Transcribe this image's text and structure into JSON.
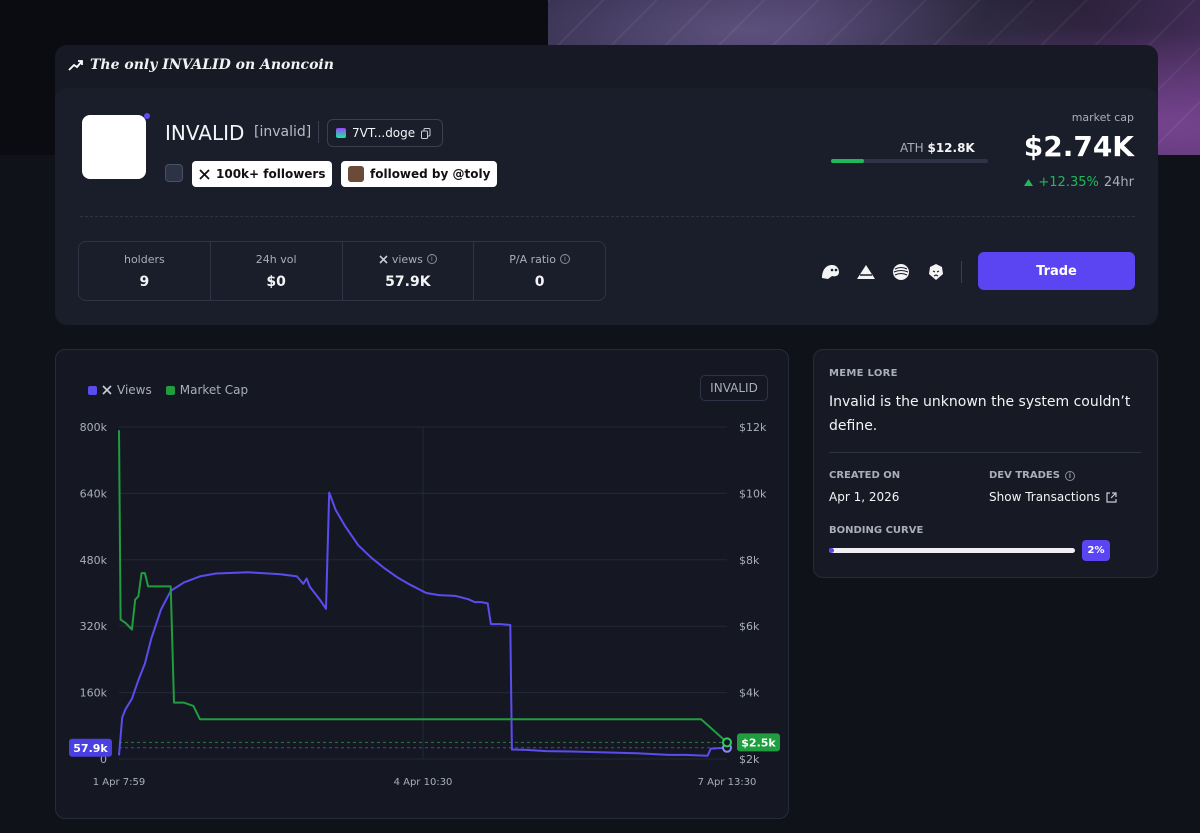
{
  "banner": {
    "title": "The only INVALID on Anoncoin"
  },
  "token": {
    "name": "INVALID",
    "ticker": "[invalid]",
    "address": "7VT...doge",
    "followers_badge": "100k+ followers",
    "followed_by_badge": "followed by @toly"
  },
  "market": {
    "ath_label": "ATH",
    "ath_value": "$12.8K",
    "ath_progress": 0.21,
    "cap_label": "market cap",
    "cap_value": "$2.74K",
    "change": "+12.35%",
    "change_period": "24hr",
    "accent_up": "#1fb85a"
  },
  "stats": [
    {
      "label": "holders",
      "value": "9",
      "info": false
    },
    {
      "label": "24h vol",
      "value": "$0",
      "info": false
    },
    {
      "label": "views",
      "value": "57.9K",
      "info": true,
      "prefix_icon": "x-logo-icon"
    },
    {
      "label": "P/A ratio",
      "value": "0",
      "info": true
    }
  ],
  "social_icons": [
    "ghost-icon",
    "triangle-icon",
    "sphere-icon",
    "lion-icon"
  ],
  "actions": {
    "trade_label": "Trade",
    "trade_color": "#5b45f2"
  },
  "chart_legend": {
    "views_label": "Views",
    "cap_label": "Market Cap",
    "tag": "INVALID"
  },
  "chart_data": {
    "type": "line",
    "x_ticks": [
      "1 Apr 7:59",
      "4 Apr 10:30",
      "7 Apr 13:30"
    ],
    "y_left_ticks": [
      "800k",
      "640k",
      "480k",
      "320k",
      "160k",
      "0"
    ],
    "y_right_ticks": [
      "$12k",
      "$10k",
      "$8k",
      "$6k",
      "$4k",
      "$2k"
    ],
    "y_left_range": [
      0,
      800000
    ],
    "y_right_range": [
      2000,
      12000
    ],
    "x_range": [
      0,
      100
    ],
    "grid": true,
    "series": [
      {
        "name": "Views",
        "axis": "left",
        "color": "#5b4cf0",
        "current_label": "57.9k",
        "points": [
          [
            0,
            9000
          ],
          [
            1,
            100000
          ],
          [
            2,
            120000
          ],
          [
            4,
            145000
          ],
          [
            6,
            190000
          ],
          [
            8,
            230000
          ],
          [
            10,
            290000
          ],
          [
            13,
            360000
          ],
          [
            16,
            405000
          ],
          [
            20,
            425000
          ],
          [
            25,
            440000
          ],
          [
            30,
            447000
          ],
          [
            40,
            450000
          ],
          [
            50,
            445000
          ],
          [
            55,
            440000
          ],
          [
            57,
            422000
          ],
          [
            58,
            435000
          ],
          [
            59,
            415000
          ],
          [
            62,
            385000
          ],
          [
            64,
            362000
          ],
          [
            65,
            642000
          ],
          [
            67,
            600000
          ],
          [
            70,
            560000
          ],
          [
            74,
            515000
          ],
          [
            78,
            485000
          ],
          [
            82,
            460000
          ],
          [
            86,
            438000
          ],
          [
            90,
            420000
          ],
          [
            95,
            400000
          ],
          [
            99,
            395000
          ],
          [
            104,
            393000
          ],
          [
            108,
            385000
          ],
          [
            110,
            378000
          ],
          [
            112,
            378000
          ],
          [
            114,
            375000
          ],
          [
            115,
            325000
          ],
          [
            118,
            325000
          ],
          [
            121,
            323000
          ],
          [
            121.5,
            23000
          ],
          [
            126,
            22000
          ],
          [
            132,
            19000
          ],
          [
            140,
            18000
          ],
          [
            150,
            16000
          ],
          [
            160,
            14000
          ],
          [
            170,
            10000
          ],
          [
            175,
            10000
          ],
          [
            182,
            8000
          ],
          [
            183,
            25000
          ],
          [
            188,
            27000
          ]
        ]
      },
      {
        "name": "Market Cap",
        "axis": "right",
        "color": "#1f9d3f",
        "current_label": "$2.5k",
        "points": [
          [
            0,
            11900
          ],
          [
            0.5,
            6200
          ],
          [
            2,
            6100
          ],
          [
            4,
            5900
          ],
          [
            5,
            6800
          ],
          [
            6,
            6900
          ],
          [
            7,
            7600
          ],
          [
            8,
            7600
          ],
          [
            9,
            7200
          ],
          [
            14,
            7200
          ],
          [
            16,
            7200
          ],
          [
            17,
            3700
          ],
          [
            20,
            3700
          ],
          [
            23,
            3600
          ],
          [
            25,
            3200
          ],
          [
            40,
            3200
          ],
          [
            60,
            3200
          ],
          [
            80,
            3200
          ],
          [
            100,
            3200
          ],
          [
            120,
            3200
          ],
          [
            140,
            3200
          ],
          [
            160,
            3200
          ],
          [
            180,
            3200
          ],
          [
            188,
            2500
          ]
        ]
      }
    ]
  },
  "lore": {
    "title": "MEME LORE",
    "text": "Invalid is the unknown the system couldn’t define.",
    "created_label": "CREATED ON",
    "created_value": "Apr 1, 2026",
    "dev_label": "DEV TRADES",
    "dev_value": "Show Transactions",
    "bonding_label": "BONDING CURVE",
    "bonding_value": "2%",
    "bonding_progress": 0.02
  }
}
